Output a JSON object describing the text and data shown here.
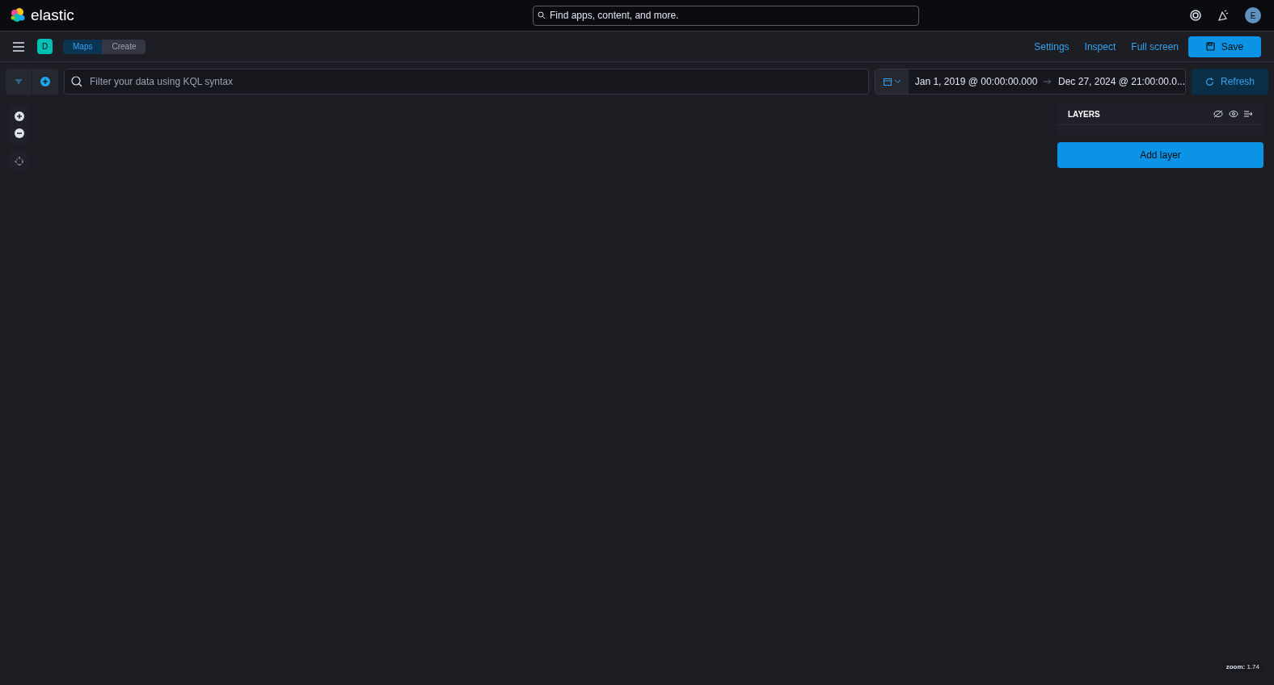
{
  "header": {
    "brand": "elastic",
    "search": {
      "placeholder": "Find apps, content, and more."
    },
    "avatar": "E"
  },
  "nav": {
    "space": "D",
    "breadcrumbs": [
      {
        "label": "Maps",
        "selected": false
      },
      {
        "label": "Create",
        "selected": true
      }
    ],
    "links": [
      "Settings",
      "Inspect",
      "Full screen"
    ],
    "save": "Save"
  },
  "query": {
    "placeholder": "Filter your data using KQL syntax",
    "start": "Jan 1, 2019 @ 00:00:00.000",
    "end": "Dec 27, 2024 @ 21:00:00.0...",
    "refresh": "Refresh"
  },
  "layers": {
    "title": "LAYERS",
    "add": "Add layer"
  },
  "zoom": "**zoom:** 1.74"
}
